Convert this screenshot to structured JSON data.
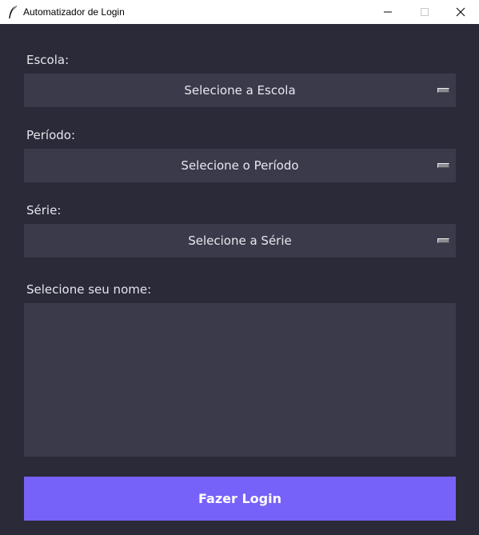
{
  "window": {
    "title": "Automatizador de Login",
    "icon": "feather-icon"
  },
  "form": {
    "escola": {
      "label": "Escola:",
      "selected": "Selecione a Escola"
    },
    "periodo": {
      "label": "Período:",
      "selected": "Selecione o Período"
    },
    "serie": {
      "label": "Série:",
      "selected": "Selecione a Série"
    },
    "nome": {
      "label": "Selecione seu nome:",
      "items": []
    },
    "submit_label": "Fazer Login"
  },
  "colors": {
    "background": "#2b2a38",
    "field": "#3b3a4a",
    "accent": "#7662f9",
    "text": "#e8e8f0"
  }
}
